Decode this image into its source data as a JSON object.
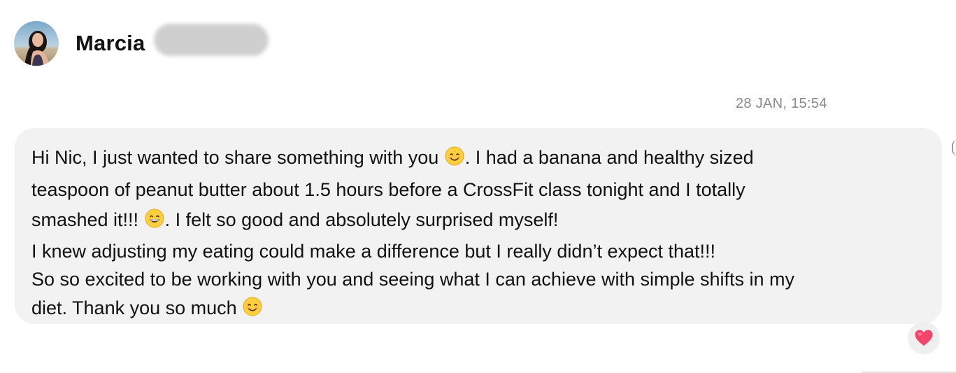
{
  "conversation": {
    "contact_name": "Marcia",
    "avatar_icon": "profile-photo",
    "redaction_color": "#cfcfcf"
  },
  "message": {
    "timestamp": "28 JAN, 15:54",
    "segments": {
      "l1a": "Hi Nic, I just wanted to share something with you",
      "l1b": ". I had a banana and healthy sized",
      "l2": "teaspoon of peanut butter about 1.5 hours before a CrossFit class tonight and I totally",
      "l3a": "smashed it!!!",
      "l3b": ". I felt so good and absolutely surprised myself!",
      "l4": "I knew adjusting my eating could make a difference but I really didn’t expect that!!!",
      "l5": "So so excited to be working with you and seeing what I can achieve with simple shifts in my",
      "l6": "diet.  Thank you so much"
    },
    "emojis": [
      "smiling-face-icon",
      "grinning-face-icon",
      "smiling-face-icon"
    ],
    "bubble_color": "#f2f2f2"
  },
  "reaction": {
    "icon": "heart-icon",
    "color": "#f0466e"
  }
}
